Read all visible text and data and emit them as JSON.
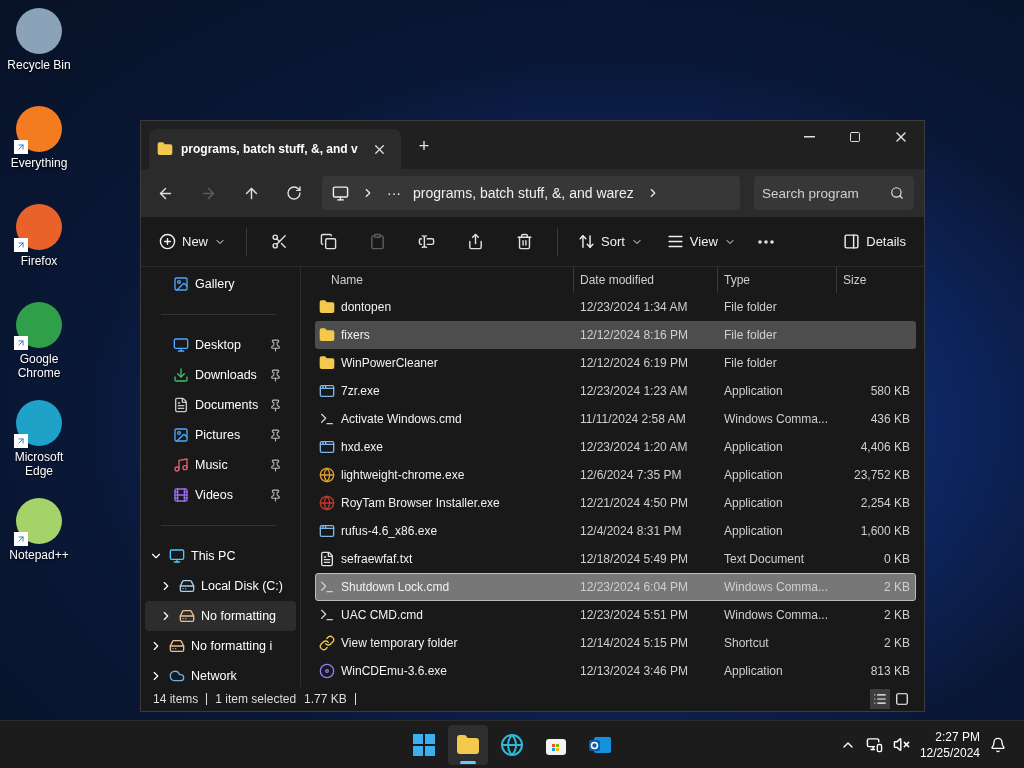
{
  "desktop_icons": [
    {
      "label": "Recycle Bin",
      "kind": "bin",
      "shortcut": false
    },
    {
      "label": "Everything",
      "kind": "search",
      "shortcut": true
    },
    {
      "label": "Firefox",
      "kind": "firefox",
      "shortcut": true
    },
    {
      "label": "Google Chrome",
      "kind": "chrome",
      "shortcut": true
    },
    {
      "label": "Microsoft Edge",
      "kind": "edge",
      "shortcut": true
    },
    {
      "label": "Notepad++",
      "kind": "notepad",
      "shortcut": true
    }
  ],
  "window": {
    "tab_title": "programs, batch stuff, &, and v",
    "tab_add": "+",
    "nav": [
      {
        "kind": "back",
        "disabled": false
      },
      {
        "kind": "forward",
        "disabled": true
      },
      {
        "kind": "up",
        "disabled": false
      },
      {
        "kind": "refresh",
        "disabled": false
      }
    ],
    "address": {
      "ellipsis": "···",
      "folder": "programs, batch stuff, &, and warez"
    },
    "search": {
      "placeholder": "Search program"
    },
    "toolbar": {
      "new": "New",
      "icon_buttons": [
        {
          "kind": "cut",
          "disabled": false
        },
        {
          "kind": "copy",
          "disabled": false
        },
        {
          "kind": "paste",
          "disabled": true
        },
        {
          "kind": "rename",
          "disabled": false
        },
        {
          "kind": "share",
          "disabled": false
        },
        {
          "kind": "delete",
          "disabled": false
        }
      ],
      "sort": "Sort",
      "view": "View",
      "details": "Details"
    },
    "sidebar": {
      "top": [
        {
          "label": "Gallery",
          "kind": "gallery"
        }
      ],
      "quick_access": [
        {
          "label": "Desktop",
          "kind": "desktop",
          "pinned": true
        },
        {
          "label": "Downloads",
          "kind": "downloads",
          "pinned": true
        },
        {
          "label": "Documents",
          "kind": "documents",
          "pinned": true
        },
        {
          "label": "Pictures",
          "kind": "pictures",
          "pinned": true
        },
        {
          "label": "Music",
          "kind": "music",
          "pinned": true
        },
        {
          "label": "Videos",
          "kind": "videos",
          "pinned": true
        }
      ],
      "tree": [
        {
          "label": "This PC",
          "kind": "pc",
          "expanded": true,
          "selected": false,
          "children": [
            {
              "label": "Local Disk (C:)",
              "kind": "disk",
              "expanded": false,
              "selected": false
            },
            {
              "label": "No formatting",
              "kind": "drive",
              "expanded": false,
              "selected": true
            }
          ]
        },
        {
          "label": "No formatting i",
          "kind": "drive",
          "expanded": false,
          "selected": false
        },
        {
          "label": "Network",
          "kind": "network",
          "expanded": false,
          "selected": false
        }
      ]
    },
    "table": {
      "columns": [
        "Name",
        "Date modified",
        "Type",
        "Size"
      ],
      "rows": [
        {
          "name": "dontopen",
          "kind": "folder",
          "date": "12/23/2024 1:34 AM",
          "type": "File folder",
          "size": "",
          "selected": false,
          "hovered": false
        },
        {
          "name": "fixers",
          "kind": "folder",
          "date": "12/12/2024 8:16 PM",
          "type": "File folder",
          "size": "",
          "selected": false,
          "hovered": true
        },
        {
          "name": "WinPowerCleaner",
          "kind": "folder",
          "date": "12/12/2024 6:19 PM",
          "type": "File folder",
          "size": "",
          "selected": false,
          "hovered": false
        },
        {
          "name": "7zr.exe",
          "kind": "app",
          "date": "12/23/2024 1:23 AM",
          "type": "Application",
          "size": "580 KB",
          "selected": false,
          "hovered": false
        },
        {
          "name": "Activate Windows.cmd",
          "kind": "cmd",
          "date": "11/11/2024 2:58 AM",
          "type": "Windows Comma...",
          "size": "436 KB",
          "selected": false,
          "hovered": false
        },
        {
          "name": "hxd.exe",
          "kind": "app",
          "date": "12/23/2024 1:20 AM",
          "type": "Application",
          "size": "4,406 KB",
          "selected": false,
          "hovered": false
        },
        {
          "name": "lightweight-chrome.exe",
          "kind": "chrome",
          "date": "12/6/2024 7:35 PM",
          "type": "Application",
          "size": "23,752 KB",
          "selected": false,
          "hovered": false
        },
        {
          "name": "RoyTam Browser Installer.exe",
          "kind": "globe",
          "date": "12/21/2024 4:50 PM",
          "type": "Application",
          "size": "2,254 KB",
          "selected": false,
          "hovered": false
        },
        {
          "name": "rufus-4.6_x86.exe",
          "kind": "app",
          "date": "12/4/2024 8:31 PM",
          "type": "Application",
          "size": "1,600 KB",
          "selected": false,
          "hovered": false
        },
        {
          "name": "sefraewfaf.txt",
          "kind": "text",
          "date": "12/18/2024 5:49 PM",
          "type": "Text Document",
          "size": "0 KB",
          "selected": false,
          "hovered": false
        },
        {
          "name": "Shutdown Lock.cmd",
          "kind": "cmd",
          "date": "12/23/2024 6:04 PM",
          "type": "Windows Comma...",
          "size": "2 KB",
          "selected": true,
          "hovered": false
        },
        {
          "name": "UAC CMD.cmd",
          "kind": "cmd",
          "date": "12/23/2024 5:51 PM",
          "type": "Windows Comma...",
          "size": "2 KB",
          "selected": false,
          "hovered": false
        },
        {
          "name": "View temporary folder",
          "kind": "shortcut",
          "date": "12/14/2024 5:15 PM",
          "type": "Shortcut",
          "size": "2 KB",
          "selected": false,
          "hovered": false
        },
        {
          "name": "WinCDEmu-3.6.exe",
          "kind": "disc",
          "date": "12/13/2024 3:46 PM",
          "type": "Application",
          "size": "813 KB",
          "selected": false,
          "hovered": false
        }
      ]
    },
    "status_bar": {
      "count": "14 items",
      "selection": "1 item selected",
      "size": "1.77 KB"
    },
    "view_modes": [
      {
        "kind": "details",
        "selected": true
      },
      {
        "kind": "tiles",
        "selected": false
      }
    ]
  },
  "taskbar": {
    "apps": [
      {
        "kind": "start",
        "active": false
      },
      {
        "kind": "explorer",
        "active": true
      },
      {
        "kind": "edge",
        "active": false
      },
      {
        "kind": "store",
        "active": false
      },
      {
        "kind": "outlook",
        "active": false
      }
    ],
    "time": "2:27 PM",
    "date": "12/25/2024"
  }
}
